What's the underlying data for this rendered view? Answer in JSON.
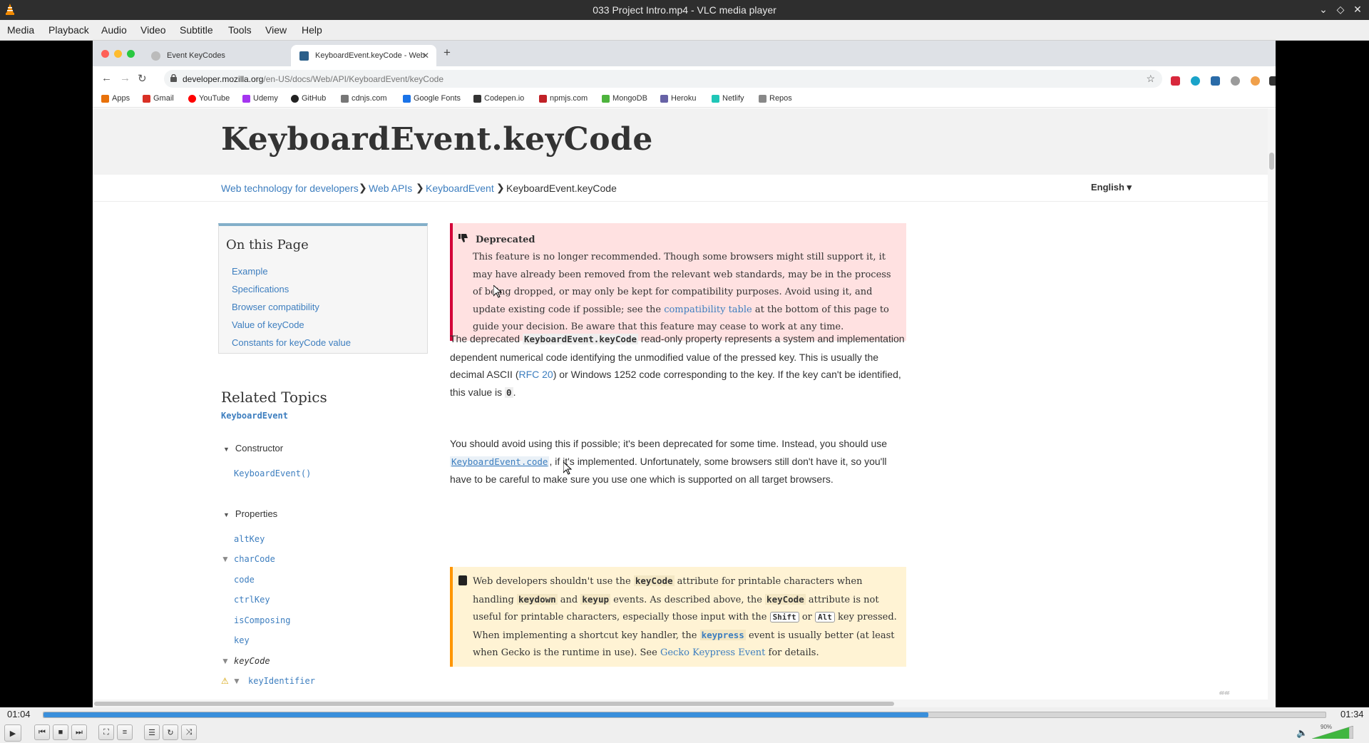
{
  "window": {
    "title": "033 Project Intro.mp4 - VLC media player"
  },
  "menu": [
    "Media",
    "Playback",
    "Audio",
    "Video",
    "Subtitle",
    "Tools",
    "View",
    "Help"
  ],
  "playback": {
    "elapsed": "01:04",
    "total": "01:34",
    "progress": 0.69,
    "volume_label": "90%",
    "volume": 0.9
  },
  "browser": {
    "tabs": [
      {
        "label": "Event KeyCodes",
        "active": false
      },
      {
        "label": "KeyboardEvent.keyCode - Web",
        "active": true
      }
    ],
    "url_host": "developer.mozilla.org",
    "url_path": "/en-US/docs/Web/API/KeyboardEvent/keyCode",
    "bookmarks": [
      "Apps",
      "Gmail",
      "YouTube",
      "Udemy",
      "GitHub",
      "cdnjs.com",
      "Google Fonts",
      "Codepen.io",
      "npmjs.com",
      "MongoDB",
      "Heroku",
      "Netlify",
      "Repos"
    ]
  },
  "page": {
    "title": "KeyboardEvent.keyCode",
    "breadcrumbs": [
      "Web technology for developers",
      "Web APIs",
      "KeyboardEvent",
      "KeyboardEvent.keyCode"
    ],
    "language": "English ▾",
    "on_this_page": {
      "heading": "On this Page",
      "links": [
        "Example",
        "Specifications",
        "Browser compatibility",
        "Value of keyCode",
        "Constants for keyCode value"
      ]
    },
    "related": {
      "heading": "Related Topics",
      "interface": "KeyboardEvent",
      "constructor_label": "Constructor",
      "constructor_item": "KeyboardEvent()",
      "properties_label": "Properties",
      "properties": [
        "altKey",
        "charCode",
        "code",
        "ctrlKey",
        "isComposing",
        "key",
        "keyCode",
        "keyIdentifier"
      ]
    },
    "deprecated": {
      "heading": "Deprecated",
      "text_before": "This feature is no longer recommended. Though some browsers might still support it, it may have already been removed from the relevant web standards, may be in the process of being dropped, or may only be kept for compatibility purposes. Avoid using it, and update existing code if possible; see the ",
      "link": "compatibility table",
      "text_after": " at the bottom of this page to guide your decision. Be aware that this feature may cease to work at any time."
    },
    "para1": {
      "a": "The deprecated ",
      "code": "KeyboardEvent.keyCode",
      "b": " read-only property represents a system and implementation dependent numerical code identifying the unmodified value of the pressed key. This is usually the decimal ASCII (",
      "link": "RFC 20",
      "c": ") or Windows 1252 code corresponding to the key. If the key can't be identified, this value is ",
      "zero": "0",
      "d": "."
    },
    "para2": {
      "a": "You should avoid using this if possible; it's been deprecated for some time. Instead, you should use ",
      "code": "KeyboardEvent.code",
      "b": ", if it's implemented. Unfortunately, some browsers still don't have it, so you'll have to be careful to make sure you use one which is supported on all target browsers."
    },
    "note": {
      "t1": "Web developers shouldn't use the ",
      "c1": "keyCode",
      "t2": " attribute for printable characters when handling ",
      "c2": "keydown",
      "t3": " and ",
      "c3": "keyup",
      "t4": " events. As described above, the ",
      "c4": "keyCode",
      "t5": " attribute is not useful for printable characters, especially those input with the ",
      "k1": "Shift",
      "t6": " or ",
      "k2": "Alt",
      "t7": " key pressed. When implementing a shortcut key handler, the ",
      "c5": "keypress",
      "t8": " event is usually better (at least when Gecko is the runtime in use). See ",
      "link": "Gecko Keypress Event",
      "t9": " for details."
    }
  },
  "colors": {
    "link": "#3d7ebf",
    "deprecated_bg": "#ffe1e1",
    "deprecated_border": "#d30038",
    "note_bg": "#fff3d4",
    "note_border": "#ff9500",
    "seek_fill": "#3a8fdb"
  }
}
